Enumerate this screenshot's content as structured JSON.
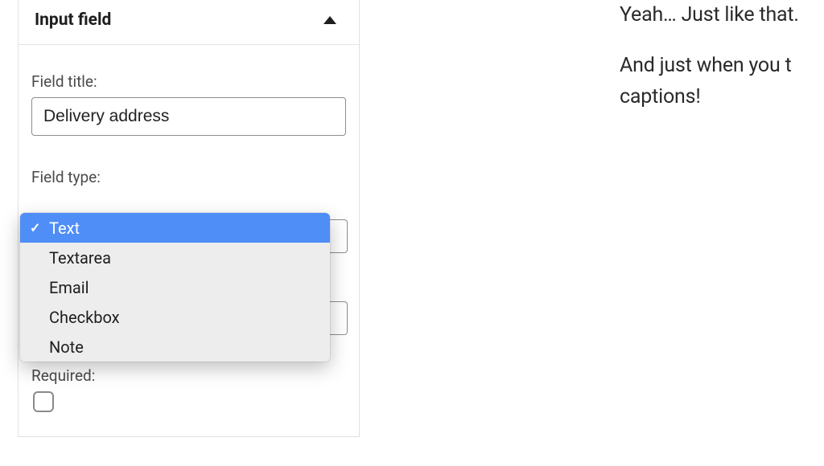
{
  "panel": {
    "title": "Input field",
    "field_title_label": "Field title:",
    "field_title_value": "Delivery address",
    "field_type_label": "Field type:",
    "required_label": "Required:",
    "required_checked": false
  },
  "dropdown": {
    "selected_index": 0,
    "options": [
      {
        "label": "Text"
      },
      {
        "label": "Textarea"
      },
      {
        "label": "Email"
      },
      {
        "label": "Checkbox"
      },
      {
        "label": "Note"
      }
    ]
  },
  "content": {
    "line1": "Yeah… Just like that.",
    "line2": "And just when you t",
    "line3": "captions!"
  }
}
